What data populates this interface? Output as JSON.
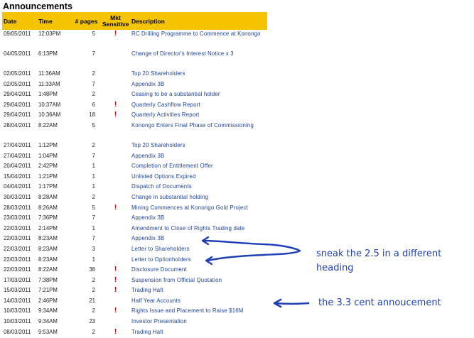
{
  "page": {
    "title": "Announcements"
  },
  "table": {
    "columns": [
      "Date",
      "Time",
      "# pages",
      "Mkt Sensitive",
      "Description"
    ],
    "sort_icon": "sort-icon",
    "rows": [
      {
        "date": "09/05/2011",
        "time": "12:03PM",
        "pages": "5",
        "mkt": "!",
        "desc": "RC Drilling Programme to Commence at Konongo"
      },
      {
        "date": "04/05/2011",
        "time": "6:13PM",
        "pages": "7",
        "mkt": "",
        "desc": "Change of Director's Interest Notice x 3"
      },
      {
        "date": "02/05/2011",
        "time": "11:36AM",
        "pages": "2",
        "mkt": "",
        "desc": "Top 20 Shareholders"
      },
      {
        "date": "02/05/2011",
        "time": "11:33AM",
        "pages": "7",
        "mkt": "",
        "desc": "Appendix 3B"
      },
      {
        "date": "29/04/2011",
        "time": "1:48PM",
        "pages": "2",
        "mkt": "",
        "desc": "Ceasing to be a substantial holder"
      },
      {
        "date": "29/04/2011",
        "time": "10:37AM",
        "pages": "6",
        "mkt": "!",
        "desc": "Quarterly Cashflow Report"
      },
      {
        "date": "29/04/2011",
        "time": "10:36AM",
        "pages": "18",
        "mkt": "!",
        "desc": "Quarterly Activities Report"
      },
      {
        "date": "28/04/2011",
        "time": "8:22AM",
        "pages": "5",
        "mkt": "",
        "desc": "Konongo Enters Final Phase of Commissioning"
      },
      {
        "date": "27/04/2011",
        "time": "1:12PM",
        "pages": "2",
        "mkt": "",
        "desc": "Top 20 Shareholders"
      },
      {
        "date": "27/04/2011",
        "time": "1:04PM",
        "pages": "7",
        "mkt": "",
        "desc": "Appendix 3B"
      },
      {
        "date": "20/04/2011",
        "time": "2:42PM",
        "pages": "1",
        "mkt": "",
        "desc": "Completion of Entitlement Offer"
      },
      {
        "date": "15/04/2011",
        "time": "1:21PM",
        "pages": "1",
        "mkt": "",
        "desc": "Unlisted Options Expired"
      },
      {
        "date": "04/04/2011",
        "time": "1:17PM",
        "pages": "1",
        "mkt": "",
        "desc": "Dispatch of Documents"
      },
      {
        "date": "30/03/2011",
        "time": "8:28AM",
        "pages": "2",
        "mkt": "",
        "desc": "Change in substantial holding"
      },
      {
        "date": "28/03/2011",
        "time": "8:26AM",
        "pages": "5",
        "mkt": "!",
        "desc": "Mining Commences at Konongo Gold Project"
      },
      {
        "date": "23/03/2011",
        "time": "7:36PM",
        "pages": "7",
        "mkt": "",
        "desc": "Appendix 3B"
      },
      {
        "date": "22/03/2011",
        "time": "2:14PM",
        "pages": "1",
        "mkt": "",
        "desc": "Amendment to Close of Rights Trading date"
      },
      {
        "date": "22/03/2011",
        "time": "8:23AM",
        "pages": "7",
        "mkt": "",
        "desc": "Appendix 3B"
      },
      {
        "date": "22/03/2011",
        "time": "8:23AM",
        "pages": "3",
        "mkt": "",
        "desc": "Letter to Shareholders"
      },
      {
        "date": "22/03/2011",
        "time": "8:23AM",
        "pages": "1",
        "mkt": "",
        "desc": "Letter to Optionholders"
      },
      {
        "date": "22/03/2011",
        "time": "8:22AM",
        "pages": "38",
        "mkt": "!",
        "desc": "Disclosure Document"
      },
      {
        "date": "17/03/2011",
        "time": "7:38PM",
        "pages": "2",
        "mkt": "!",
        "desc": "Suspension from Official Quotation"
      },
      {
        "date": "15/03/2011",
        "time": "7:21PM",
        "pages": "2",
        "mkt": "!",
        "desc": "Trading Halt"
      },
      {
        "date": "14/03/2011",
        "time": "2:46PM",
        "pages": "21",
        "mkt": "",
        "desc": "Half Year Accounts"
      },
      {
        "date": "10/03/2011",
        "time": "9:34AM",
        "pages": "2",
        "mkt": "!",
        "desc": "Rights Issue and Placement to Raise $16M"
      },
      {
        "date": "10/03/2011",
        "time": "9:34AM",
        "pages": "23",
        "mkt": "",
        "desc": "Investor Presentation"
      },
      {
        "date": "08/03/2011",
        "time": "9:53AM",
        "pages": "2",
        "mkt": "!",
        "desc": "Trading Halt"
      }
    ]
  },
  "annotations": {
    "note1_line1": "sneak the 2.5 in a different",
    "note1_line2": "heading",
    "note2": "the 3.3 cent annoucement",
    "ink_color": "#1f3fb4"
  }
}
